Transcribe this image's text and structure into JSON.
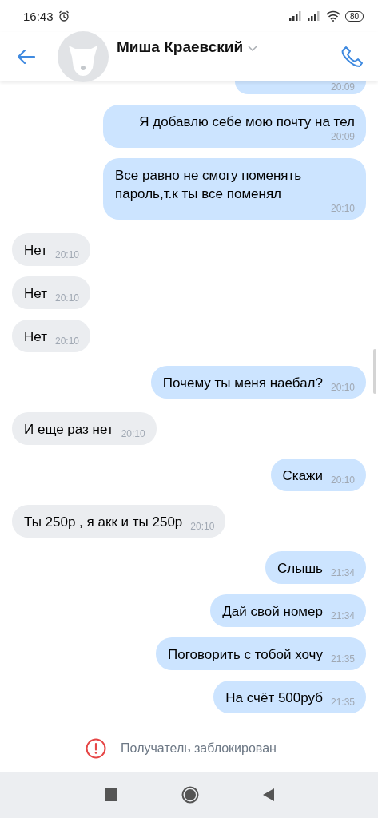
{
  "status_bar": {
    "time": "16:43",
    "battery": "80"
  },
  "header": {
    "name": "Миша Краевский"
  },
  "messages": [
    {
      "kind": "outgoing",
      "partial": true,
      "time": "20:09"
    },
    {
      "kind": "outgoing",
      "text": "Я добавлю себе мою почту на тел",
      "time": "20:09"
    },
    {
      "kind": "outgoing",
      "text": "Все равно не смогу поменять пароль,т.к ты все поменял",
      "time": "20:10"
    },
    {
      "kind": "incoming",
      "text": "Нет",
      "time": "20:10"
    },
    {
      "kind": "incoming",
      "text": "Нет",
      "time": "20:10"
    },
    {
      "kind": "incoming",
      "text": "Нет",
      "time": "20:10"
    },
    {
      "kind": "outgoing",
      "text": "Почему ты меня наебал?",
      "time": "20:10"
    },
    {
      "kind": "incoming",
      "text": "И еще раз нет",
      "time": "20:10"
    },
    {
      "kind": "outgoing",
      "text": "Скажи",
      "time": "20:10"
    },
    {
      "kind": "incoming",
      "text": "Ты 250р , я акк и ты 250р",
      "time": "20:10"
    },
    {
      "kind": "outgoing",
      "text": "Слышь",
      "time": "21:34"
    },
    {
      "kind": "outgoing",
      "text": "Дай свой номер",
      "time": "21:34"
    },
    {
      "kind": "outgoing",
      "text": "Поговорить с тобой хочу",
      "time": "21:35"
    },
    {
      "kind": "outgoing",
      "text": "На счёт 500руб",
      "time": "21:35"
    }
  ],
  "blocked_notice": "Получатель заблокирован"
}
